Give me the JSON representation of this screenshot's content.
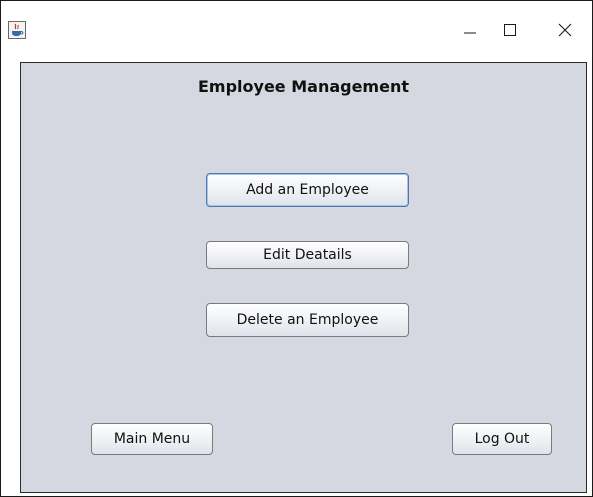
{
  "window": {
    "controls": {
      "minimize_icon": "minimize-icon",
      "maximize_icon": "maximize-icon",
      "close_icon": "close-icon"
    }
  },
  "panel": {
    "heading": "Employee Management",
    "buttons": {
      "add": "Add an Employee",
      "edit": "Edit Deatails",
      "delete": "Delete an Employee",
      "main_menu": "Main Menu",
      "log_out": "Log Out"
    }
  },
  "colors": {
    "panel_background": "#d5d8e0",
    "focus_border": "#4a78b0"
  }
}
